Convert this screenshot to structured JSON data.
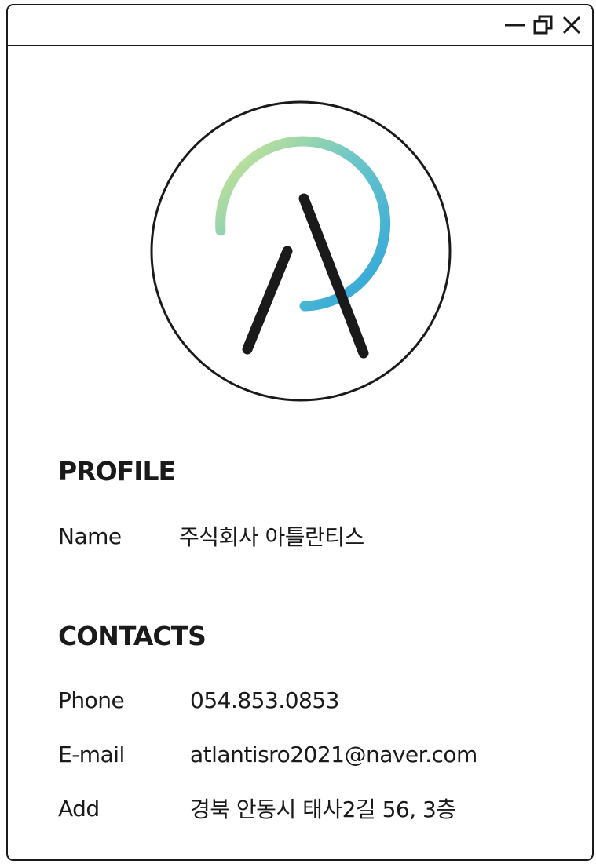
{
  "window": {
    "controls": {
      "minimize_icon": "minimize-icon",
      "restore_icon": "restore-icon",
      "close_icon": "close-icon"
    }
  },
  "logo": {
    "icon": "company-logo",
    "colors": {
      "gradient_start": "#d6e88a",
      "gradient_mid": "#6dc7c8",
      "gradient_end": "#2aa3dc",
      "stroke": "#1a1a1a"
    }
  },
  "profile": {
    "heading": "PROFILE",
    "name_label": "Name",
    "name_value": "주식회사 아틀란티스"
  },
  "contacts": {
    "heading": "CONTACTS",
    "phone_label": "Phone",
    "phone_value": "054.853.0853",
    "email_label": "E-mail",
    "email_value": "atlantisro2021@naver.com",
    "address_label": "Add",
    "address_value": "경북 안동시 태사2길 56, 3층"
  }
}
